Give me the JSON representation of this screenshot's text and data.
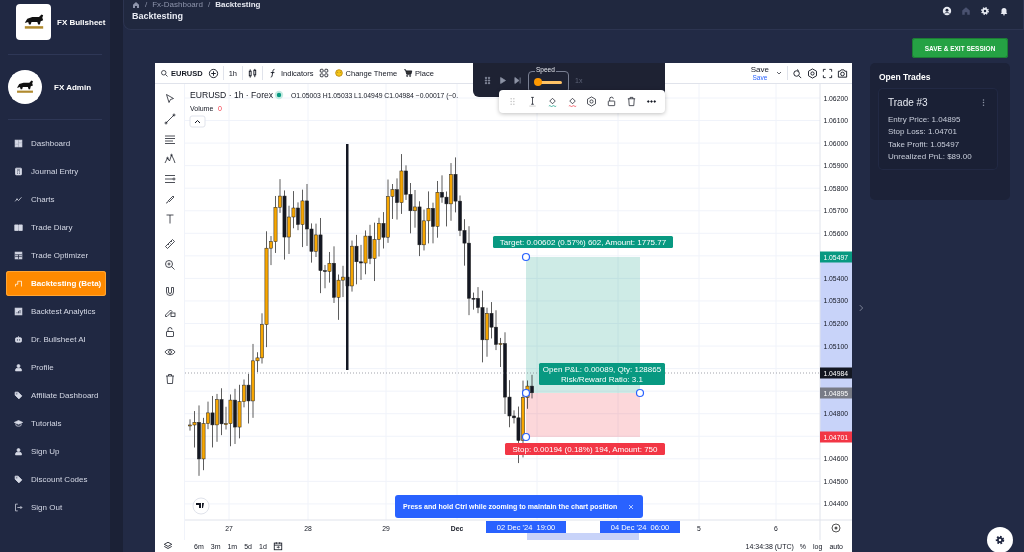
{
  "sidebar": {
    "brand": "FX Bullsheet",
    "user": "FX Admin",
    "items": [
      {
        "label": "Dashboard",
        "selected": false
      },
      {
        "label": "Journal Entry",
        "selected": false
      },
      {
        "label": "Charts",
        "selected": false
      },
      {
        "label": "Trade Diary",
        "selected": false
      },
      {
        "label": "Trade Optimizer",
        "selected": false
      },
      {
        "label": "Backtesting (Beta)",
        "selected": true
      },
      {
        "label": "Backtest Analytics",
        "selected": false
      },
      {
        "label": "Dr. Bullsheet AI",
        "selected": false
      },
      {
        "label": "Profile",
        "selected": false
      },
      {
        "label": "Affiliate Dashboard",
        "selected": false
      },
      {
        "label": "Tutorials",
        "selected": false
      },
      {
        "label": "Sign Up",
        "selected": false
      },
      {
        "label": "Discount Codes",
        "selected": false
      },
      {
        "label": "Sign Out",
        "selected": false
      }
    ]
  },
  "header": {
    "breadcrumb": [
      {
        "separator": "/",
        "label": "Fx-Dashboard"
      },
      {
        "separator": "/",
        "label": "Backtesting"
      }
    ],
    "title": "Backtesting"
  },
  "save_exit_button": "SAVE & EXIT SESSION",
  "chart": {
    "toolbar": {
      "symbol": "EURUSD",
      "interval": "1h",
      "indicators": "Indicators",
      "change_theme": "Change Theme",
      "place": "Place",
      "save": "Save",
      "save_sub": "Save"
    },
    "replay": {
      "speed_label": "Speed",
      "level": 0.1,
      "speed": "1x"
    },
    "legend": {
      "title": "EURUSD · 1h · Forex",
      "ohlc": "O1.05003 H1.05033 L1.04949 C1.04984 −0.00017 (−0.",
      "volume_label": "Volume",
      "volume": "0"
    },
    "price_ticks": [
      "1.06200",
      "1.06100",
      "1.06000",
      "1.05900",
      "1.05800",
      "1.05700",
      "1.05600",
      "1.05400",
      "1.05300",
      "1.05200",
      "1.05100",
      "1.04800",
      "1.04600",
      "1.04500",
      "1.04400"
    ],
    "price_markers": [
      {
        "label": "1.05497",
        "color": "#089981"
      },
      {
        "label": "1.04984",
        "color": "#131722"
      },
      {
        "label": "1.04895",
        "color": "#787b86"
      },
      {
        "label": "1.04701",
        "color": "#f23645"
      }
    ],
    "position": {
      "target": "Target: 0.00602 (0.57%) 602, Amount: 1775.77",
      "open_pnl": "Open P&L: 0.00089, Qty: 128865",
      "ratio": "Risk/Reward Ratio: 3.1",
      "stop": "Stop: 0.00194 (0.18%) 194, Amount: 750"
    },
    "time_ticks": [
      "27",
      "28",
      "29",
      "Dec",
      "5",
      "6"
    ],
    "time_markers": [
      "02 Dec '24  19:00",
      "04 Dec '24  06:00"
    ],
    "toast": "Press and hold Ctrl while zooming to maintain the chart position",
    "ranges": [
      "6m",
      "3m",
      "1m",
      "5d",
      "1d"
    ],
    "clock": "14:34:38 (UTC)",
    "scale_options": [
      "%",
      "log",
      "auto"
    ]
  },
  "open_trades": {
    "title": "Open Trades",
    "trade": {
      "title": "Trade #3",
      "lines": [
        "Entry Price: 1.04895",
        "Stop Loss: 1.04701",
        "Take Profit: 1.05497",
        "Unrealized PnL: $89.00"
      ]
    }
  }
}
